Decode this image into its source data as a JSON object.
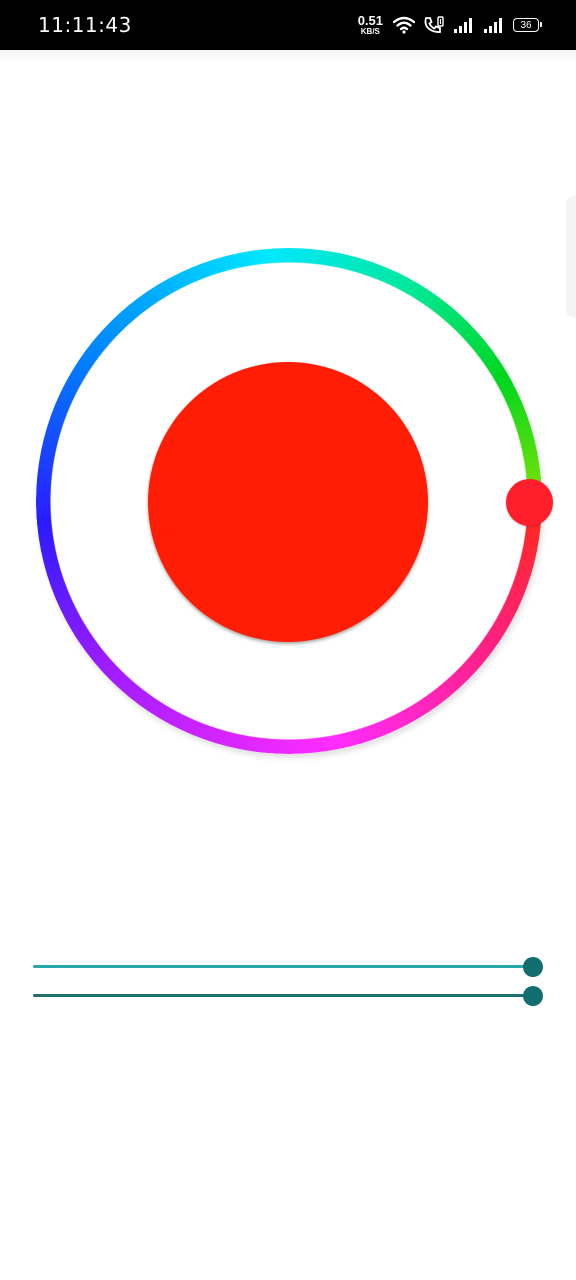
{
  "status_bar": {
    "time": "11:11:43",
    "net_speed_value": "0.51",
    "net_speed_unit": "KB/S",
    "battery_level": "36"
  },
  "color_wheel": {
    "selected_color": "#ff1e05",
    "thumb_color": "#ff1e2a"
  },
  "sliders": {
    "accent_color": "#116d6e",
    "track_color_top": "#28a7a8",
    "track_color_bottom": "#1f6f70",
    "brightness_fraction": 0.98,
    "saturation_fraction": 0.98
  }
}
